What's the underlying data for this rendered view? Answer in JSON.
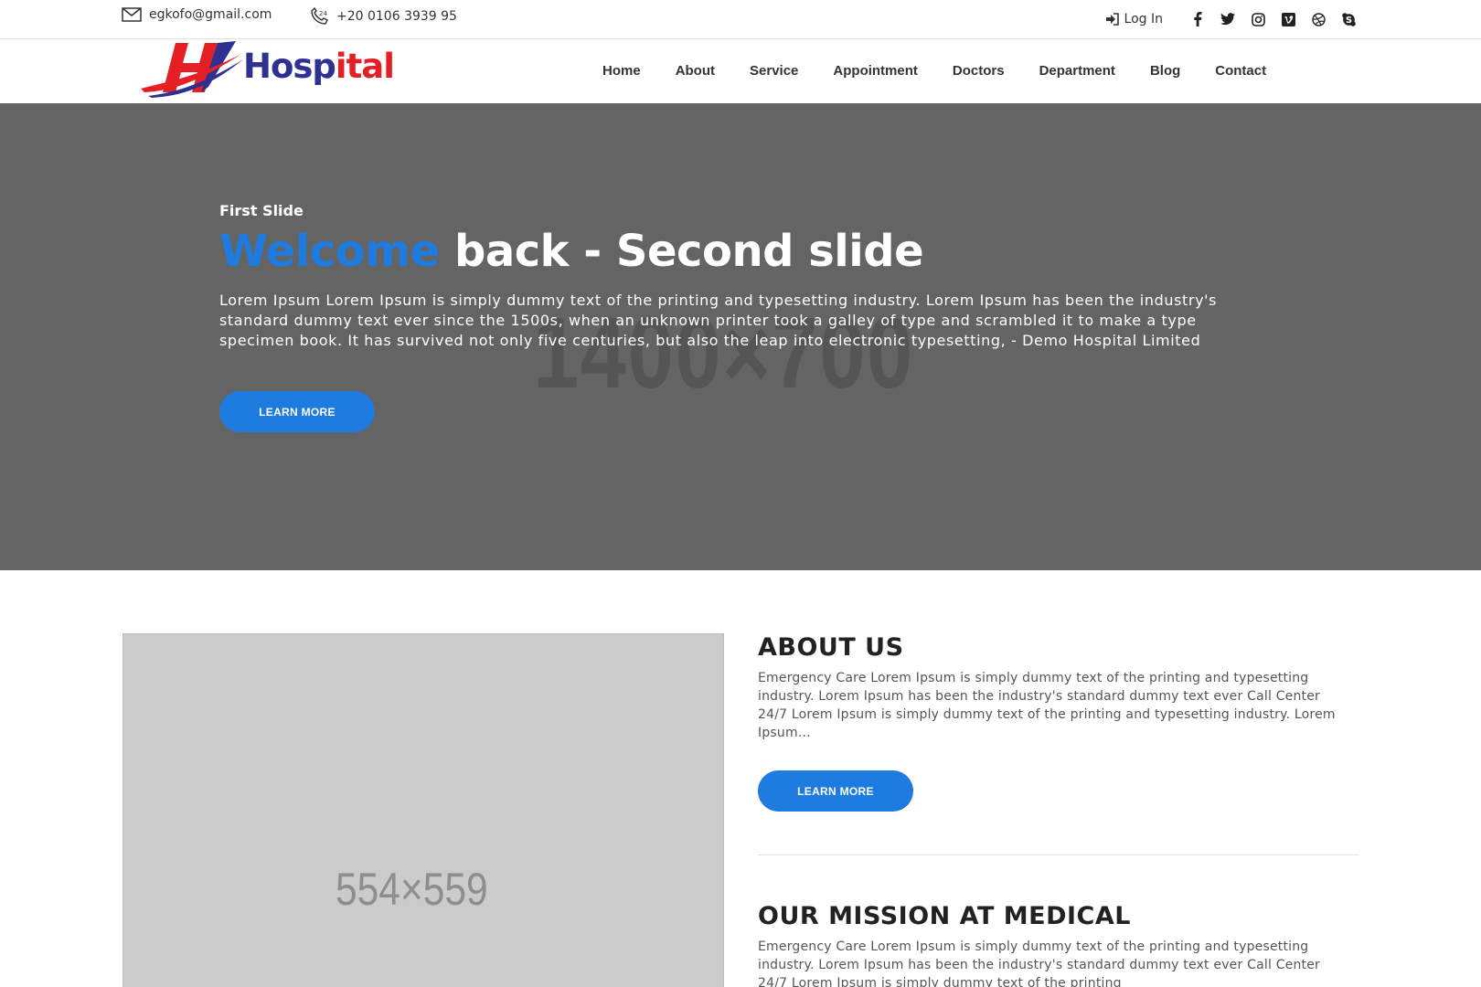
{
  "topbar": {
    "email": "egkofo@gmail.com",
    "phone": "+20 0106 3939 95",
    "login": "Log In",
    "social_icons": [
      "facebook-icon",
      "twitter-icon",
      "instagram-icon",
      "vimeo-icon",
      "dribbble-icon",
      "skype-icon"
    ]
  },
  "logo": {
    "letter": "H",
    "text_part1": "Hosp",
    "text_part2": "ital",
    "colors": {
      "blue": "#2e3192",
      "red": "#e41f26"
    }
  },
  "nav": {
    "items": [
      "Home",
      "About",
      "Service",
      "Appointment",
      "Doctors",
      "Department",
      "Blog",
      "Contact"
    ]
  },
  "hero": {
    "kicker": "First Slide",
    "title_accent": "Welcome",
    "title_rest": " back - Second slide",
    "text": "Lorem Ipsum Lorem Ipsum is simply dummy text of the printing and typesetting industry. Lorem Ipsum has been the industry's standard dummy text ever since the 1500s, when an unknown printer took a galley of type and scrambled it to make a type specimen book. It has survived not only five centuries, but also the leap into electronic typesetting, - Demo Hospital Limited",
    "button": "LEARN MORE",
    "placeholder_label": "1400×700",
    "background": "#646464",
    "accent": "#1e7be0"
  },
  "about": {
    "image_label": "554×559",
    "title": "ABOUT US",
    "text": "Emergency Care Lorem Ipsum is simply dummy text of the printing and typesetting industry. Lorem Ipsum has been the industry's standard dummy text ever Call Center 24/7 Lorem Ipsum is simply dummy text of the printing and typesetting industry. Lorem Ipsum...",
    "button": "LEARN MORE"
  },
  "mission": {
    "title": "OUR MISSION AT MEDICAL",
    "text": "Emergency Care Lorem Ipsum is simply dummy text of the printing and typesetting industry. Lorem Ipsum has been the industry's standard dummy text ever Call Center 24/7 Lorem Ipsum is simply dummy text of the printing"
  }
}
